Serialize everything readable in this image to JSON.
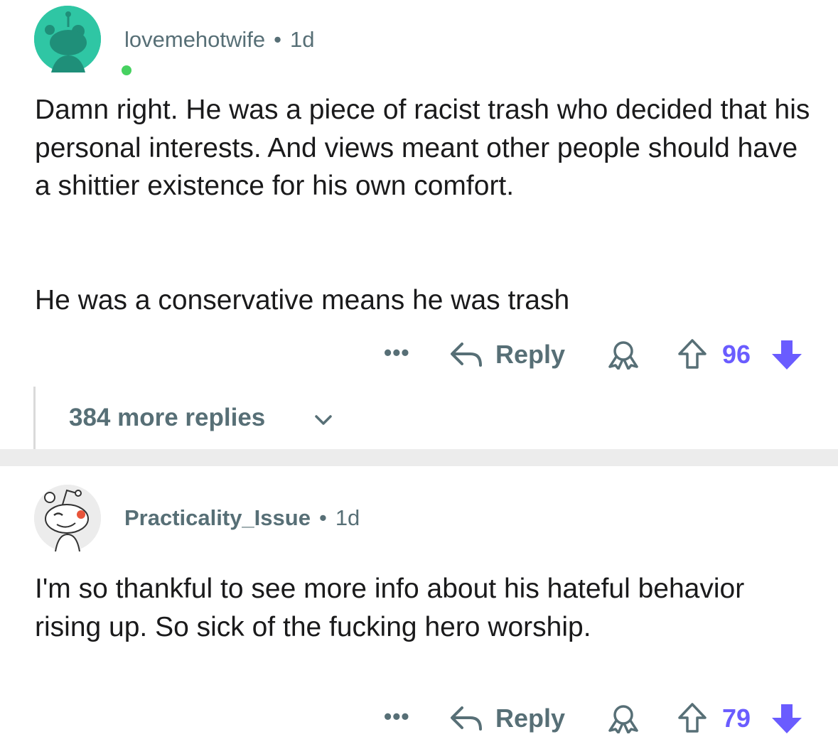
{
  "comments": [
    {
      "username": "lovemehotwife",
      "separator": "•",
      "age": "1d",
      "paragraphs": [
        "Damn right. He was a piece of racist trash who decided that his personal interests. And views meant other people should have a shittier existence for his own comfort.",
        "He was a conservative means he was trash"
      ],
      "more_label": "•••",
      "reply_label": "Reply",
      "score": "96",
      "avatar_icon": "snoo-avatar-teal",
      "online_status": "online",
      "more_replies_label": "384 more replies"
    },
    {
      "username": "Practicality_Issue",
      "separator": "•",
      "age": "1d",
      "paragraphs": [
        "I'm so thankful to see more info about his hateful behavior rising up. So sick of the fucking hero worship."
      ],
      "more_label": "•••",
      "reply_label": "Reply",
      "score": "79",
      "avatar_icon": "snoo-avatar-winking"
    }
  ],
  "colors": {
    "vote_accent": "#6a5cff",
    "meta_text": "#576f76",
    "avatar_teal": "#2fc6a4",
    "online_green": "#46d160",
    "separator": "#ececec"
  }
}
